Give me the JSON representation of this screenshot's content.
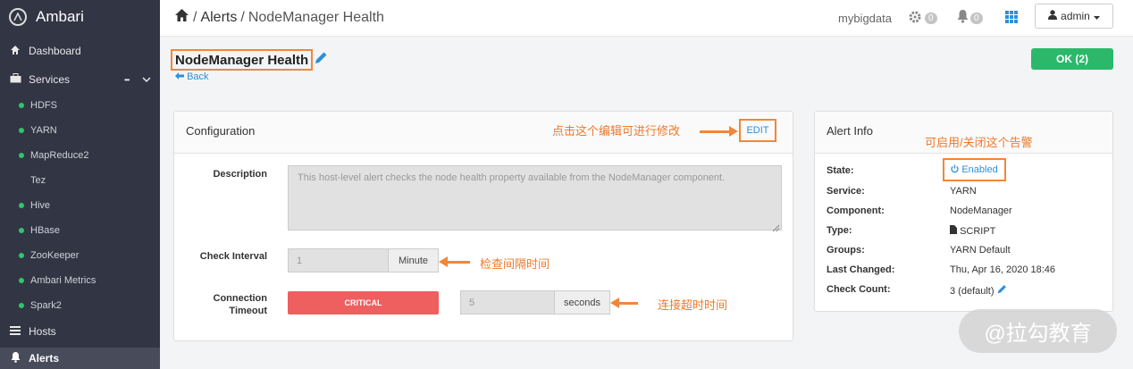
{
  "app": {
    "brand": "Ambari"
  },
  "sidebar": {
    "dashboard": "Dashboard",
    "services": "Services",
    "services_more": "•••",
    "service_items": [
      "HDFS",
      "YARN",
      "MapReduce2",
      "Tez",
      "Hive",
      "HBase",
      "ZooKeeper",
      "Ambari Metrics",
      "Spark2"
    ],
    "hosts": "Hosts",
    "alerts": "Alerts"
  },
  "topbar": {
    "breadcrumb_root": "Alerts",
    "breadcrumb_sep": "/",
    "breadcrumb_current": "NodeManager Health",
    "cluster": "mybigdata",
    "ops_count": "0",
    "alerts_count": "0",
    "user": "admin"
  },
  "alert": {
    "title": "NodeManager Health",
    "back": "Back",
    "status_button": "OK (2)"
  },
  "config": {
    "title": "Configuration",
    "edit": "EDIT",
    "description_label": "Description",
    "description": "This host-level alert checks the node health property available from the NodeManager component.",
    "interval_label": "Check Interval",
    "interval_value": "1",
    "interval_unit": "Minute",
    "timeout_label_1": "Connection",
    "timeout_label_2": "Timeout",
    "critical": "CRITICAL",
    "timeout_value": "5",
    "timeout_unit": "seconds"
  },
  "info": {
    "title": "Alert Info",
    "labels": {
      "state": "State:",
      "service": "Service:",
      "component": "Component:",
      "type": "Type:",
      "groups": "Groups:",
      "last_changed": "Last Changed:",
      "check_count": "Check Count:"
    },
    "values": {
      "state": "Enabled",
      "service": "YARN",
      "component": "NodeManager",
      "type": "SCRIPT",
      "groups": "YARN Default",
      "last_changed": "Thu, Apr 16, 2020 18:46",
      "check_count": "3 (default)"
    }
  },
  "annotations": {
    "edit_note": "点击这个编辑可进行修改",
    "enable_note": "可启用/关闭这个告警",
    "interval_note": "检查间隔时间",
    "timeout_note": "连接超时时间"
  },
  "watermark": "@拉勾教育",
  "colors": {
    "accent": "#2e8fd8",
    "ok": "#2bb86a",
    "critical": "#ee5f60",
    "annotation": "#f0873a",
    "sidebar": "#323544"
  }
}
